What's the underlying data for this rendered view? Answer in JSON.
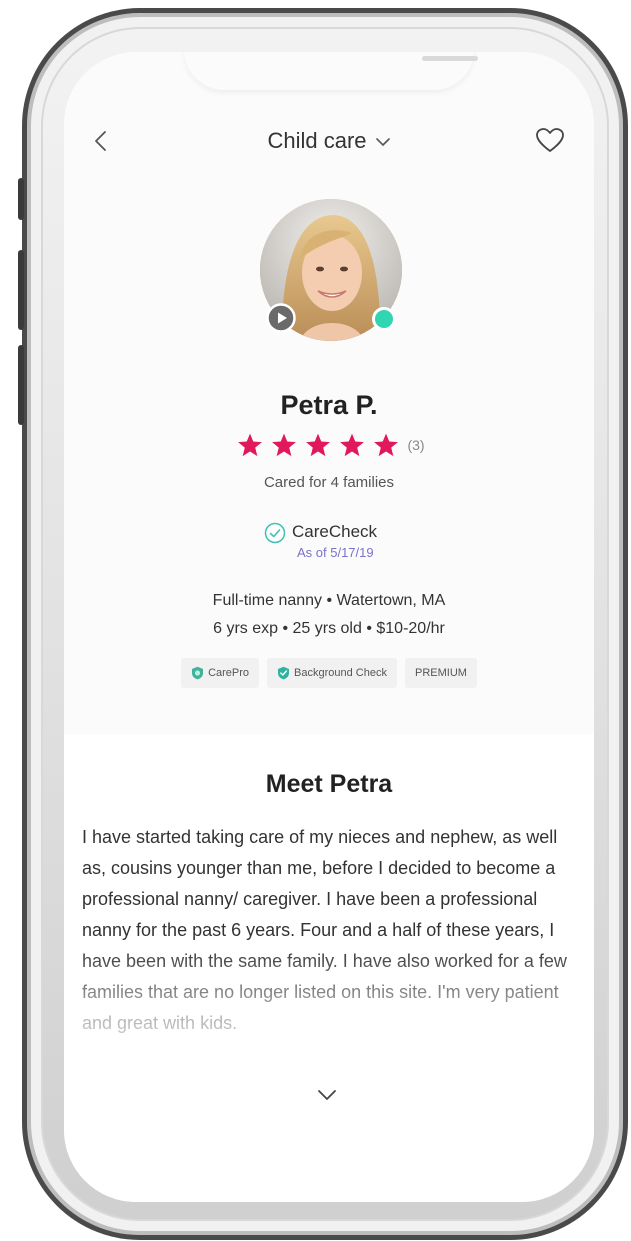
{
  "header": {
    "title": "Child care",
    "back_icon": "chevron-left-icon",
    "dropdown_icon": "chevron-down-icon",
    "favorite_icon": "heart-outline-icon"
  },
  "profile": {
    "name": "Petra P.",
    "rating_stars": 5,
    "review_count": "(3)",
    "cared_for": "Cared for 4 families",
    "carecheck_label": "CareCheck",
    "carecheck_date": "As of 5/17/19",
    "details_line1": "Full-time nanny • Watertown, MA",
    "details_line2": "6 yrs exp • 25 yrs old • $10-20/hr",
    "online": true
  },
  "badges": [
    {
      "label": "CarePro",
      "icon": "carepro-shield-icon"
    },
    {
      "label": "Background Check",
      "icon": "check-shield-icon"
    },
    {
      "label": "PREMIUM",
      "icon": ""
    }
  ],
  "about": {
    "title": "Meet Petra",
    "bio": "I have started taking care of my nieces and nephew, as well as, cousins younger than me, before I decided to become a professional nanny/ caregiver. I have been a professional nanny for the past 6 years. Four and a half of these years, I have been with the same family. I have also worked for a few families that are no longer listed on this site. I'm very patient and great with kids."
  },
  "colors": {
    "star": "#e0195a",
    "online": "#2fd6b1",
    "carecheck_date": "#7a72c8",
    "carecheck_icon": "#3fc0b5"
  }
}
